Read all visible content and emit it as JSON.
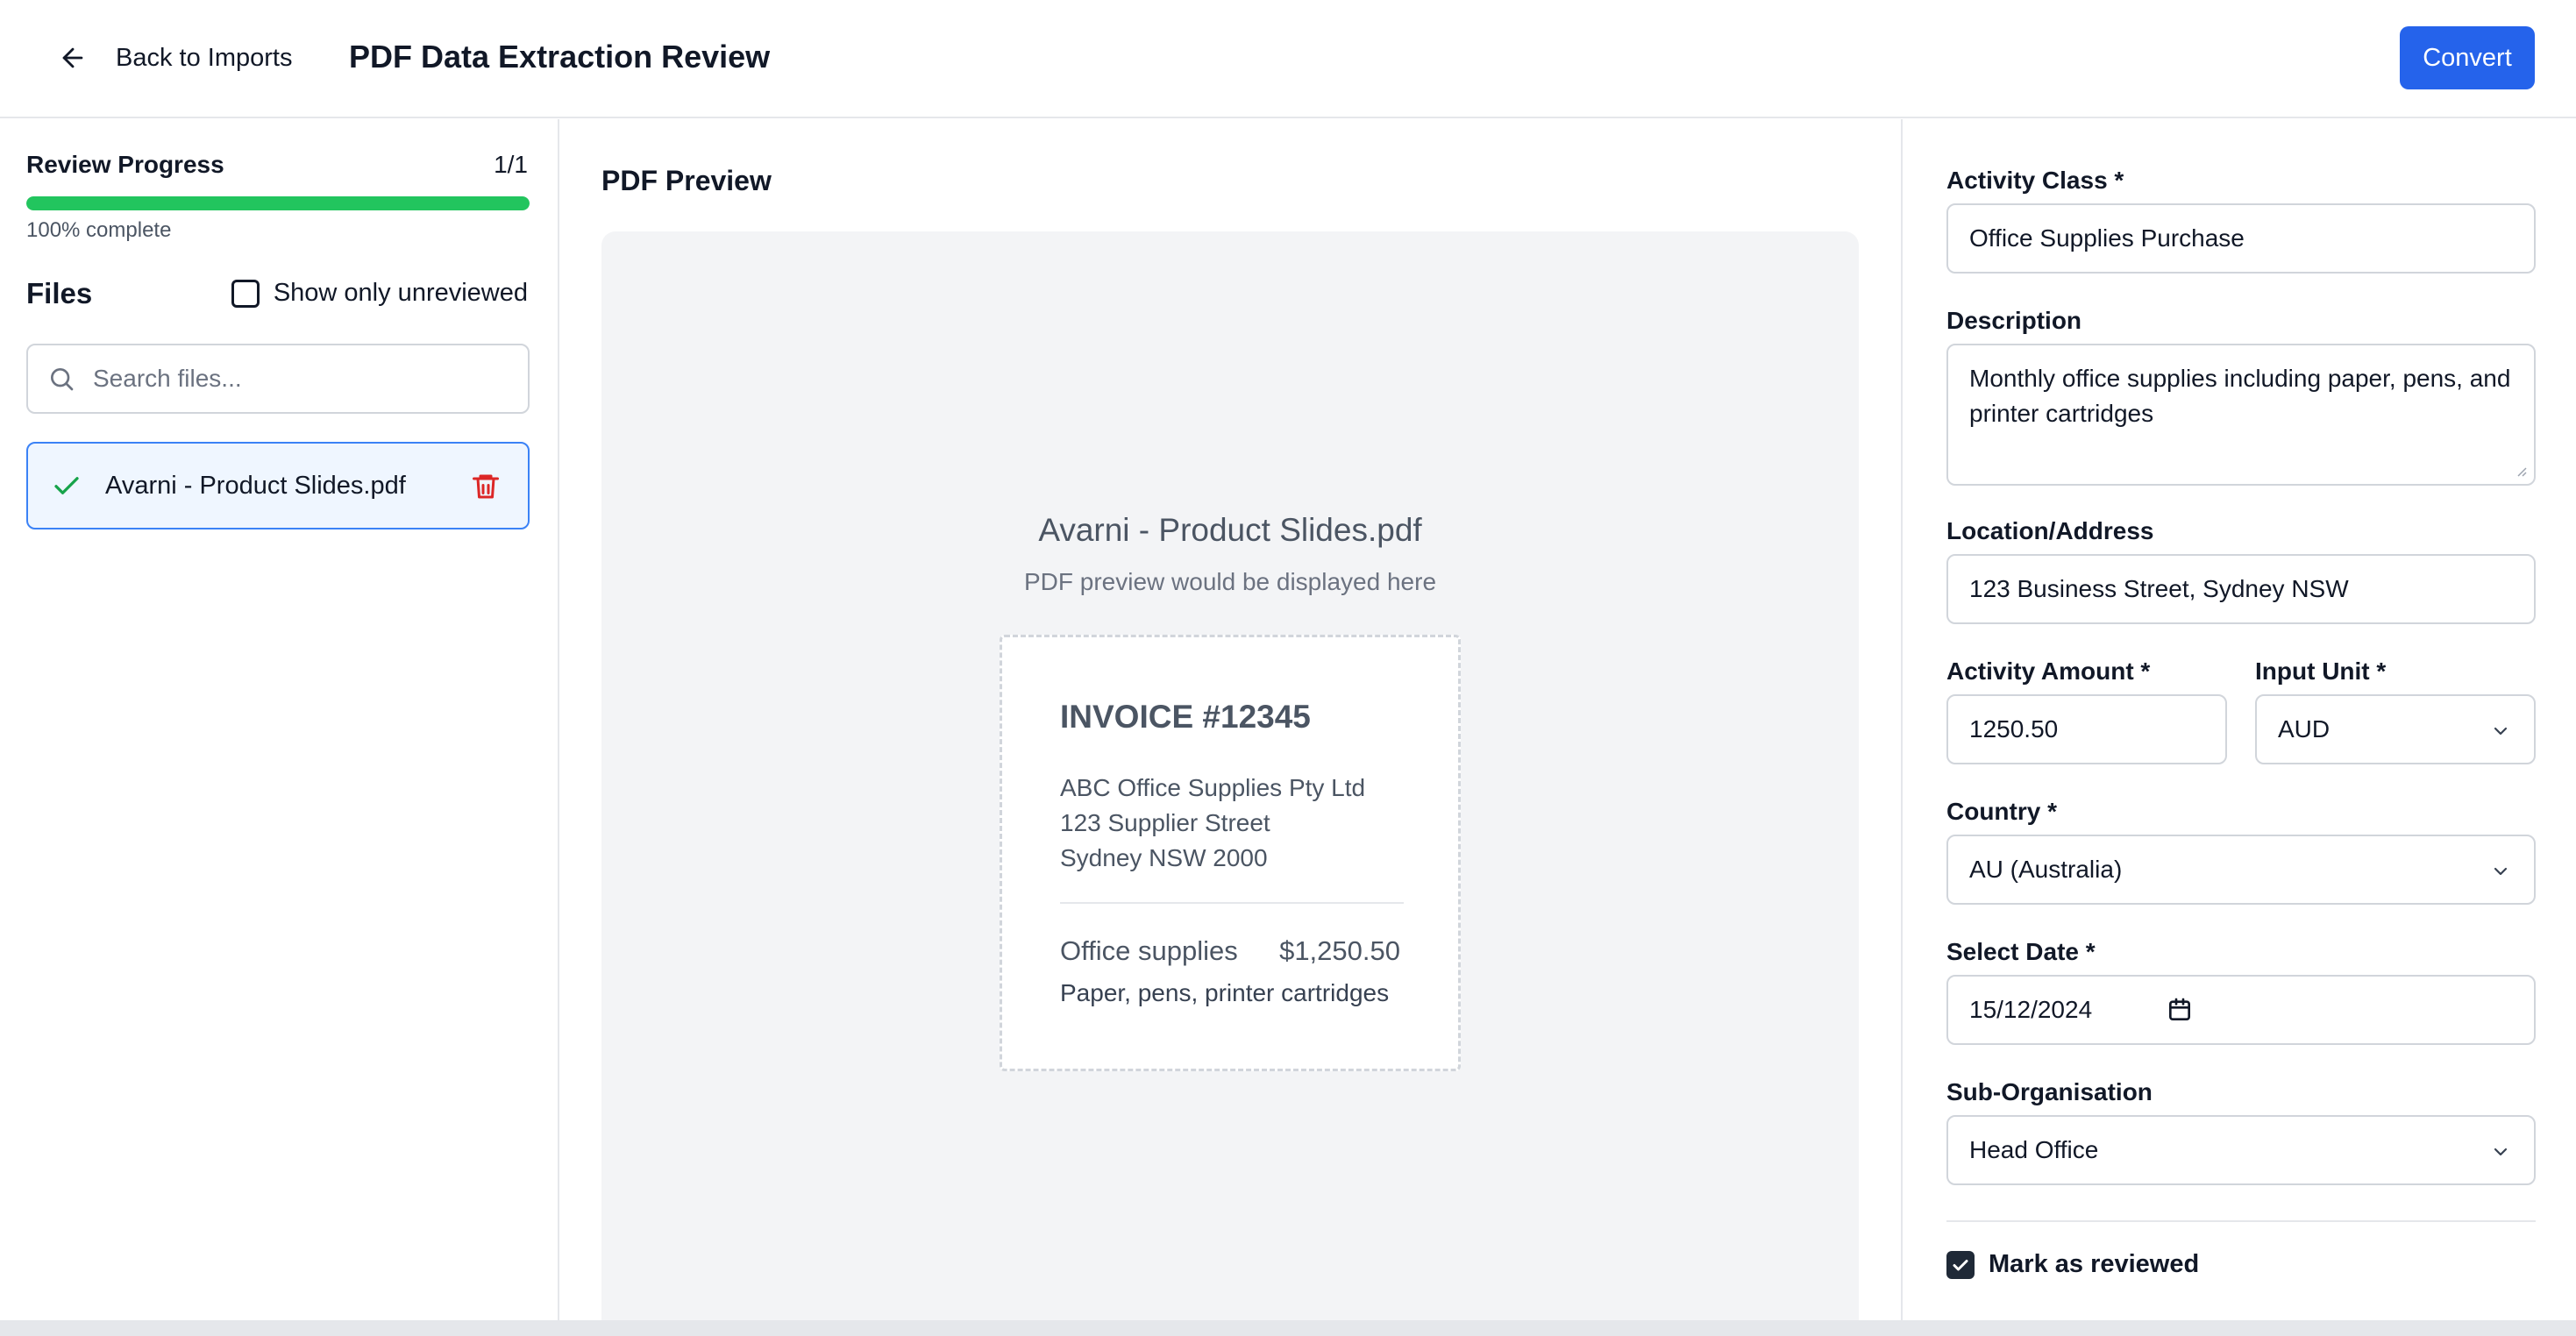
{
  "header": {
    "back_label": "Back to Imports",
    "title": "PDF Data Extraction Review",
    "convert_label": "Convert",
    "accent_color": "#2563eb"
  },
  "sidebar": {
    "progress_title": "Review Progress",
    "progress_count": "1/1",
    "progress_fraction": 1.0,
    "progress_text": "100% complete",
    "progress_color": "#22c55e",
    "files_title": "Files",
    "show_unreviewed_label": "Show only unreviewed",
    "show_unreviewed_checked": false,
    "search_placeholder": "Search files...",
    "files": [
      {
        "name": "Avarni - Product Slides.pdf",
        "reviewed": true,
        "selected": true
      }
    ]
  },
  "preview": {
    "title": "PDF Preview",
    "file_name": "Avarni - Product Slides.pdf",
    "subtitle": "PDF preview would be displayed here",
    "invoice": {
      "title": "INVOICE #12345",
      "address_lines": [
        "ABC Office Supplies Pty Ltd",
        "123 Supplier Street",
        "Sydney NSW 2000"
      ],
      "item": "Office supplies",
      "amount": "$1,250.50",
      "item_desc": "Paper, pens, printer cartridges"
    }
  },
  "form": {
    "activity_class_label": "Activity Class *",
    "activity_class_value": "Office Supplies Purchase",
    "description_label": "Description",
    "description_value": "Monthly office supplies including paper, pens, and printer cartridges",
    "location_label": "Location/Address",
    "location_value": "123 Business Street, Sydney NSW",
    "activity_amount_label": "Activity Amount *",
    "activity_amount_value": "1250.50",
    "input_unit_label": "Input Unit *",
    "input_unit_value": "AUD",
    "country_label": "Country *",
    "country_value": "AU (Australia)",
    "date_label": "Select Date *",
    "date_value": "15/12/2024",
    "sub_org_label": "Sub-Organisation",
    "sub_org_value": "Head Office",
    "mark_reviewed_label": "Mark as reviewed",
    "mark_reviewed_checked": true
  }
}
